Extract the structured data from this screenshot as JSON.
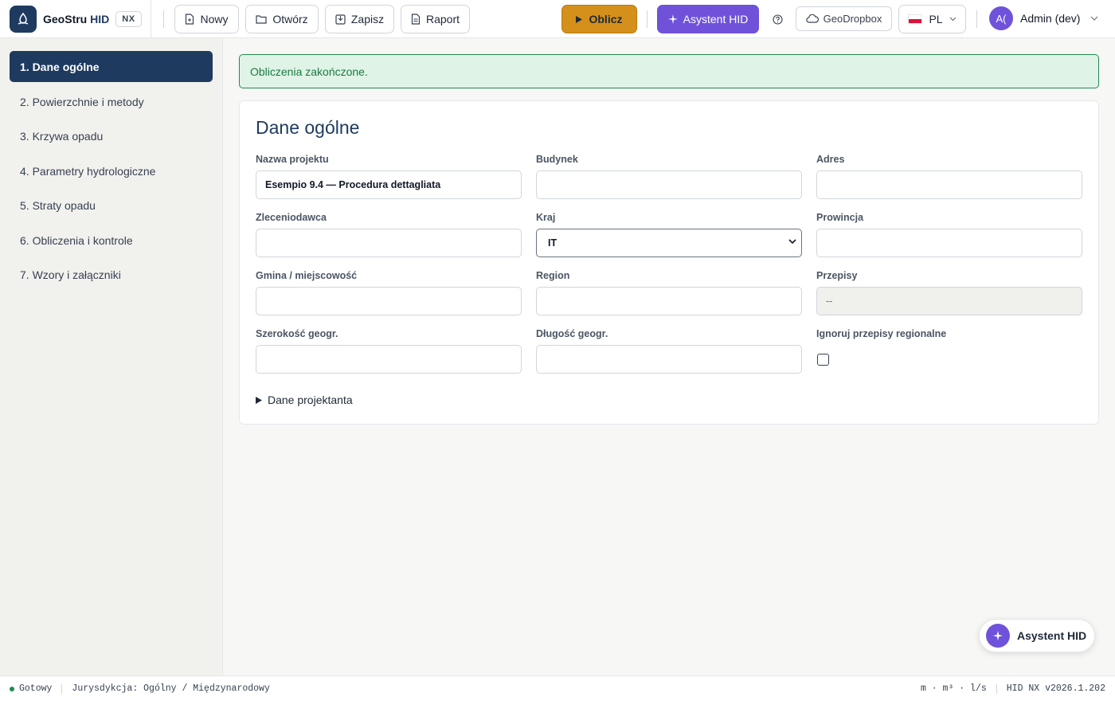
{
  "brand": {
    "name": "GeoStru",
    "hid": "HID",
    "badge": "NX"
  },
  "toolbar": {
    "new_label": "Nowy",
    "open_label": "Otwórz",
    "save_label": "Zapisz",
    "report_label": "Raport",
    "compute_label": "Oblicz",
    "assistant_label": "Asystent HID",
    "cloud_label": "GeoDropbox",
    "lang_label": "PL",
    "user_initials": "A(",
    "user_name": "Admin (dev)"
  },
  "sidebar": {
    "items": [
      {
        "label": "1. Dane ogólne",
        "active": true
      },
      {
        "label": "2. Powierzchnie i metody",
        "active": false
      },
      {
        "label": "3. Krzywa opadu",
        "active": false
      },
      {
        "label": "4. Parametry hydrologiczne",
        "active": false
      },
      {
        "label": "5. Straty opadu",
        "active": false
      },
      {
        "label": "6. Obliczenia i kontrole",
        "active": false
      },
      {
        "label": "7. Wzory i załączniki",
        "active": false
      }
    ]
  },
  "alert": {
    "message": "Obliczenia zakończone."
  },
  "form": {
    "title": "Dane ogólne",
    "project_name": {
      "label": "Nazwa projektu",
      "value": "Esempio 9.4 — Procedura dettagliata"
    },
    "building": {
      "label": "Budynek",
      "value": ""
    },
    "address": {
      "label": "Adres",
      "value": ""
    },
    "client": {
      "label": "Zleceniodawca",
      "value": ""
    },
    "country": {
      "label": "Kraj",
      "value": "IT"
    },
    "province": {
      "label": "Prowincja",
      "value": ""
    },
    "municipality": {
      "label": "Gmina / miejscowość",
      "value": ""
    },
    "region": {
      "label": "Region",
      "value": ""
    },
    "regulations": {
      "label": "Przepisy",
      "value": "--"
    },
    "latitude": {
      "label": "Szerokość geogr.",
      "value": ""
    },
    "longitude": {
      "label": "Długość geogr.",
      "value": ""
    },
    "ignore_regional": {
      "label": "Ignoruj przepisy regionalne",
      "checked": false
    },
    "designer_toggle": "Dane projektanta"
  },
  "fab": {
    "label": "Asystent HID"
  },
  "statusbar": {
    "status": "Gotowy",
    "jurisdiction": "Jurysdykcja: Ogólny / Międzynarodowy",
    "units": "m · m³ · l/s",
    "version": "HID NX v2026.1.202"
  },
  "colors": {
    "primary": "#1e3a5f",
    "accent": "#d4901a",
    "assistant": "#6f52d9",
    "success": "#1f8a4c"
  }
}
